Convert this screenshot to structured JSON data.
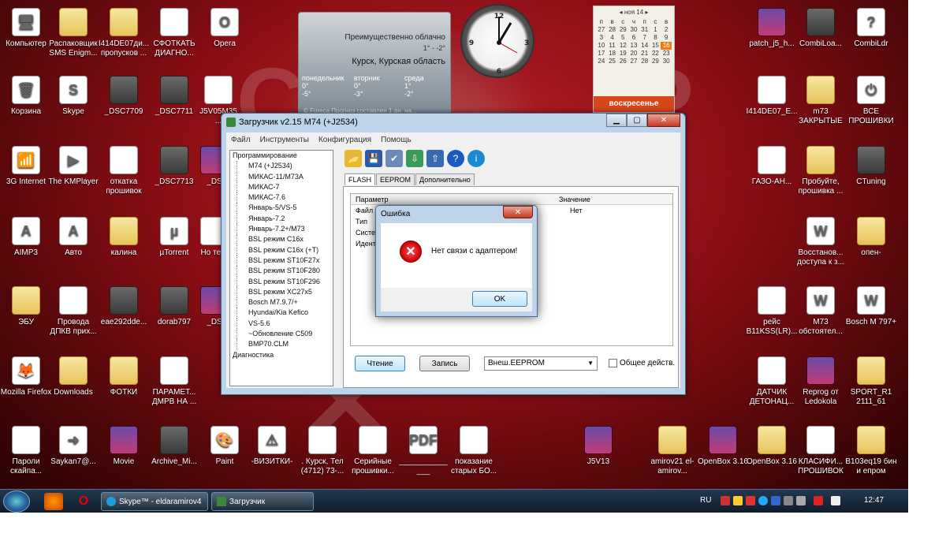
{
  "desktop_icons": [
    {
      "label": "Компьютер",
      "icon": "computer-icon",
      "cls": "doc",
      "glyph": "🖥"
    },
    {
      "label": "Распаковщик SMS Enigm...",
      "icon": "folder-icon",
      "cls": "folder",
      "glyph": ""
    },
    {
      "label": "I414DE07ди... пропусков ...",
      "icon": "folder-icon",
      "cls": "folder",
      "glyph": ""
    },
    {
      "label": "СФОТКАТЬ ДИАГНО...",
      "icon": "document-icon",
      "cls": "doc",
      "glyph": ""
    },
    {
      "label": "Opera",
      "icon": "opera-icon",
      "cls": "doc",
      "glyph": "O"
    },
    {
      "label": "Корзина",
      "icon": "recycle-bin-icon",
      "cls": "doc",
      "glyph": "🗑"
    },
    {
      "label": "Skype",
      "icon": "skype-icon",
      "cls": "doc",
      "glyph": "S"
    },
    {
      "label": "_DSC7709",
      "icon": "photo-icon",
      "cls": "photo",
      "glyph": ""
    },
    {
      "label": "_DSC7711",
      "icon": "photo-icon",
      "cls": "photo",
      "glyph": ""
    },
    {
      "label": "3G Internet",
      "icon": "3g-internet-icon",
      "cls": "doc",
      "glyph": "📶"
    },
    {
      "label": "The KMPlayer",
      "icon": "kmplayer-icon",
      "cls": "doc",
      "glyph": "▶"
    },
    {
      "label": "откатка прошивок",
      "icon": "document-icon",
      "cls": "doc",
      "glyph": ""
    },
    {
      "label": "_DSC7713",
      "icon": "photo-icon",
      "cls": "photo",
      "glyph": ""
    },
    {
      "label": "AIMP3",
      "icon": "aimp-icon",
      "cls": "doc",
      "glyph": "A"
    },
    {
      "label": "Авто",
      "icon": "autocad-icon",
      "cls": "doc",
      "glyph": "A"
    },
    {
      "label": "калина",
      "icon": "folder-icon",
      "cls": "folder",
      "glyph": ""
    },
    {
      "label": "µTorrent",
      "icon": "utorrent-icon",
      "cls": "doc",
      "glyph": "µ"
    },
    {
      "label": "ЭБУ",
      "icon": "folder-icon",
      "cls": "folder",
      "glyph": ""
    },
    {
      "label": "Провода ДПКВ прих...",
      "icon": "document-icon",
      "cls": "doc",
      "glyph": ""
    },
    {
      "label": "eae292dde...",
      "icon": "photo-icon",
      "cls": "photo",
      "glyph": ""
    },
    {
      "label": "dorab797",
      "icon": "photo-icon",
      "cls": "photo",
      "glyph": ""
    },
    {
      "label": "Mozilla Firefox",
      "icon": "firefox-icon",
      "cls": "doc",
      "glyph": "🦊"
    },
    {
      "label": "Downloads",
      "icon": "folder-icon",
      "cls": "folder",
      "glyph": ""
    },
    {
      "label": "ФОТКИ",
      "icon": "folder-icon",
      "cls": "folder",
      "glyph": ""
    },
    {
      "label": "ПАРАМЕТ... ДМРВ НА ...",
      "icon": "document-icon",
      "cls": "doc",
      "glyph": ""
    },
    {
      "label": "Пароли скайпа...",
      "icon": "document-icon",
      "cls": "doc",
      "glyph": ""
    },
    {
      "label": "Saykan7@...",
      "icon": "shortcut-icon",
      "cls": "doc",
      "glyph": "➜"
    },
    {
      "label": "Movie",
      "icon": "winrar-icon",
      "cls": "winrar",
      "glyph": ""
    },
    {
      "label": "Archive_Mi...",
      "icon": "archive-icon",
      "cls": "photo",
      "glyph": ""
    },
    {
      "label": "Paint",
      "icon": "paint-icon",
      "cls": "doc",
      "glyph": "🎨"
    },
    {
      "label": "-ВИЗИТКИ-",
      "icon": "warning-icon",
      "cls": "doc",
      "glyph": "⚠"
    },
    {
      "label": ". Курск, Тел (4712) 73-...",
      "icon": "document-icon",
      "cls": "doc",
      "glyph": ""
    },
    {
      "label": "Серийные прошивки...",
      "icon": "document-icon",
      "cls": "doc",
      "glyph": ""
    },
    {
      "label": "______________",
      "icon": "pdf-icon",
      "cls": "doc",
      "glyph": "PDF"
    },
    {
      "label": "показание старых БО...",
      "icon": "document-icon",
      "cls": "doc",
      "glyph": ""
    },
    {
      "label": "J5V13",
      "icon": "winrar-icon",
      "cls": "winrar",
      "glyph": ""
    },
    {
      "label": "amirov21 el-amirov...",
      "icon": "folder-icon",
      "cls": "folder",
      "glyph": ""
    },
    {
      "label": "OpenBox 3.16",
      "icon": "winrar-icon",
      "cls": "winrar",
      "glyph": ""
    },
    {
      "label": "OpenBox 3.16",
      "icon": "folder-icon",
      "cls": "folder",
      "glyph": ""
    },
    {
      "label": "КЛАСИФИ... ПРОШИВОК",
      "icon": "document-icon",
      "cls": "doc",
      "glyph": ""
    },
    {
      "label": "B103eq19 бин и епром",
      "icon": "folder-icon",
      "cls": "folder",
      "glyph": ""
    },
    {
      "label": "patch_j5_h...",
      "icon": "winrar-icon",
      "cls": "winrar",
      "glyph": ""
    },
    {
      "label": "CombiLoa...",
      "icon": "chip-icon",
      "cls": "photo",
      "glyph": ""
    },
    {
      "label": "CombiLdr",
      "icon": "help-icon",
      "cls": "doc",
      "glyph": "?"
    },
    {
      "label": "I414DE07_E...",
      "icon": "document-icon",
      "cls": "doc",
      "glyph": ""
    },
    {
      "label": "m73 ЗАКРЫТЫЕ",
      "icon": "chip-icon",
      "cls": "folder",
      "glyph": ""
    },
    {
      "label": "ВСЕ ПРОШИВКИ",
      "icon": "power-icon",
      "cls": "doc",
      "glyph": "⏻"
    },
    {
      "label": "ГАЗО-АН...",
      "icon": "document-icon",
      "cls": "doc",
      "glyph": ""
    },
    {
      "label": "Пробуйте, прошивка ...",
      "icon": "folder-icon",
      "cls": "folder",
      "glyph": ""
    },
    {
      "label": "CTuning",
      "icon": "chip-icon",
      "cls": "photo",
      "glyph": ""
    },
    {
      "label": "Восстанов... доступа к з...",
      "icon": "word-doc-icon",
      "cls": "doc",
      "glyph": "W"
    },
    {
      "label": "опен-",
      "icon": "briefcase-icon",
      "cls": "folder",
      "glyph": ""
    },
    {
      "label": "рейс B11KSS(LR)...",
      "icon": "document-icon",
      "cls": "doc",
      "glyph": ""
    },
    {
      "label": "M73 обстоятел...",
      "icon": "word-doc-icon",
      "cls": "doc",
      "glyph": "W"
    },
    {
      "label": "Bosch M 797+",
      "icon": "word-doc-icon",
      "cls": "doc",
      "glyph": "W"
    },
    {
      "label": "ДАТЧИК ДЕТОНАЦ...",
      "icon": "document-icon",
      "cls": "doc",
      "glyph": ""
    },
    {
      "label": "Reprog от Ledokola",
      "icon": "winrar-icon",
      "cls": "winrar",
      "glyph": ""
    },
    {
      "label": "SPORT_R1 2111_61",
      "icon": "folder-icon",
      "cls": "folder",
      "glyph": ""
    }
  ],
  "partial_icons": [
    {
      "label": "J5V05M35..."
    },
    {
      "label": "_DS"
    },
    {
      "label": "Но текс"
    },
    {
      "label": "_DS"
    }
  ],
  "weather": {
    "condition": "Преимущественно облачно",
    "temps": "1° - -2°",
    "city": "Курск, Курская область",
    "forecast": [
      {
        "day": "понедельник",
        "hi": "0°",
        "lo": "-5°"
      },
      {
        "day": "вторник",
        "hi": "0°",
        "lo": "-3°"
      },
      {
        "day": "среда",
        "hi": "1°",
        "lo": "-2°"
      }
    ],
    "footer": "© Foreca  Прогноз составлен 1 дн. на..."
  },
  "calendar": {
    "month": "ноя 14",
    "weekday_headers": [
      "п",
      "в",
      "с",
      "ч",
      "п",
      "с",
      "в"
    ],
    "rows": [
      [
        "27",
        "28",
        "29",
        "30",
        "31",
        "1",
        "2"
      ],
      [
        "3",
        "4",
        "5",
        "6",
        "7",
        "8",
        "9"
      ],
      [
        "10",
        "11",
        "12",
        "13",
        "14",
        "15",
        "16"
      ],
      [
        "17",
        "18",
        "19",
        "20",
        "21",
        "22",
        "23"
      ],
      [
        "24",
        "25",
        "26",
        "27",
        "28",
        "29",
        "30"
      ]
    ],
    "today": "16",
    "weekday_name": "воскресенье"
  },
  "window": {
    "title": "Загрузчик v2.15 M74 (+J2534)",
    "menu": [
      "Файл",
      "Инструменты",
      "Конфигурация",
      "Помощь"
    ],
    "tree_root": "Программирование",
    "tree_children": [
      "M74 (+J2534)",
      "МИКАС-11/M73A",
      "МИКАС-7",
      "МИКАС-7.6",
      "Январь-5/VS-5",
      "Январь-7.2",
      "Январь-7.2+/M73",
      "BSL режим C16x",
      "BSL режим C16x (+T)",
      "BSL режим ST10F27x",
      "BSL режим ST10F280",
      "BSL режим ST10F296",
      "BSL режим XC27x5",
      "Bosch M7.9.7/+",
      "Hyundai/Kia Kefico",
      "VS-5.6",
      "~Обновление C509",
      "BMP70.CLM"
    ],
    "tree_root2": "Диагностика",
    "tabs": [
      "FLASH",
      "EEPROM",
      "Дополнительно"
    ],
    "col_param": "Параметр",
    "col_value": "Значение",
    "rows": [
      {
        "p": "Файл",
        "v": "Нет"
      },
      {
        "p": "Тип",
        "v": ""
      },
      {
        "p": "Систе",
        "v": ""
      },
      {
        "p": "Идент",
        "v": ""
      }
    ],
    "read_btn": "Чтение",
    "write_btn": "Запись",
    "select_value": "Внеш.EEPROM",
    "checkbox_label": "Общее действ."
  },
  "dialog": {
    "title": "Ошибка",
    "message": "Нет связи с адаптером!",
    "ok": "OK"
  },
  "taskbar": {
    "tasks": [
      {
        "label": "Skype™ - eldaramirov4"
      },
      {
        "label": "Загрузчик"
      }
    ],
    "lang": "RU",
    "time": "12:47"
  }
}
